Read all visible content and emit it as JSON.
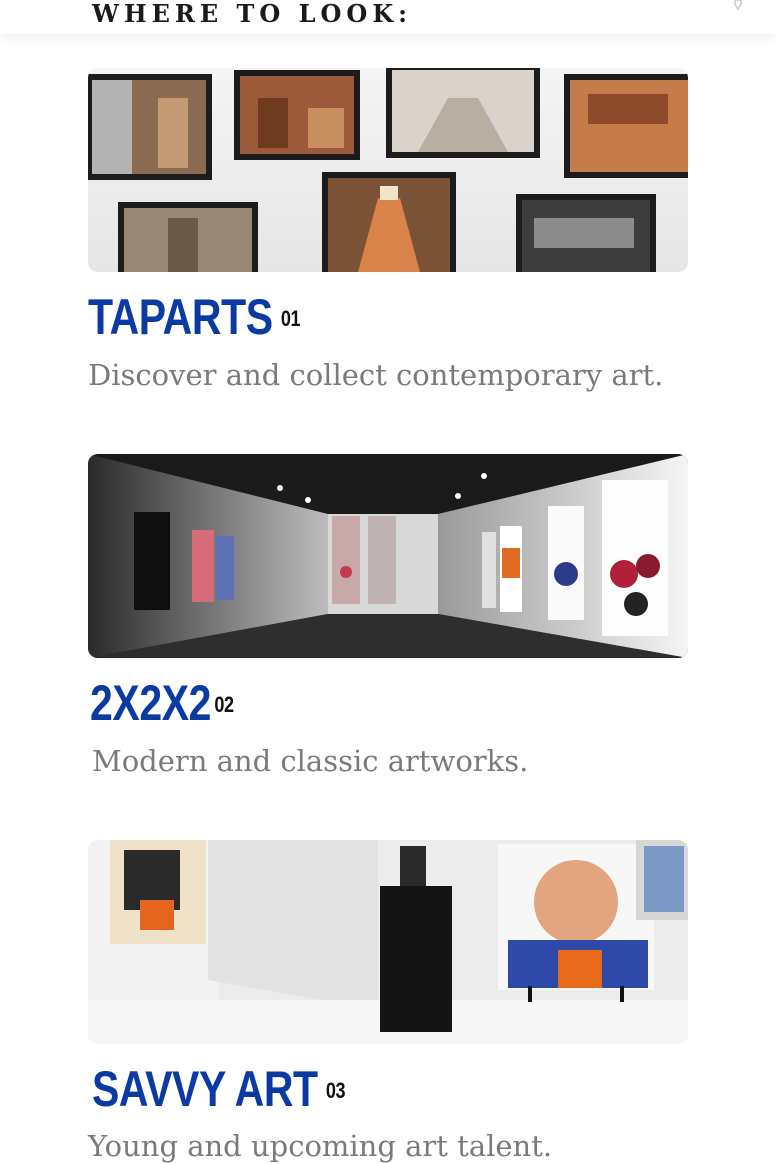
{
  "header": {
    "heading": "WHERE TO LOOK:"
  },
  "cards": [
    {
      "title": "TAPARTS",
      "number": "01",
      "description": "Discover and collect contemporary art.",
      "image": "gallery-wall-of-framed-photos"
    },
    {
      "title": "2X2X2",
      "number": "02",
      "description": "Modern and classic artworks.",
      "image": "dark-gallery-hall-with-paintings"
    },
    {
      "title": "SAVVY ART",
      "number": "03",
      "description": "Young and upcoming art talent.",
      "image": "white-gallery-with-pedestal-and-portrait"
    }
  ],
  "colors": {
    "title": "#0b3aa3",
    "description": "#7a7a7a",
    "heading": "#1a1a1a"
  }
}
